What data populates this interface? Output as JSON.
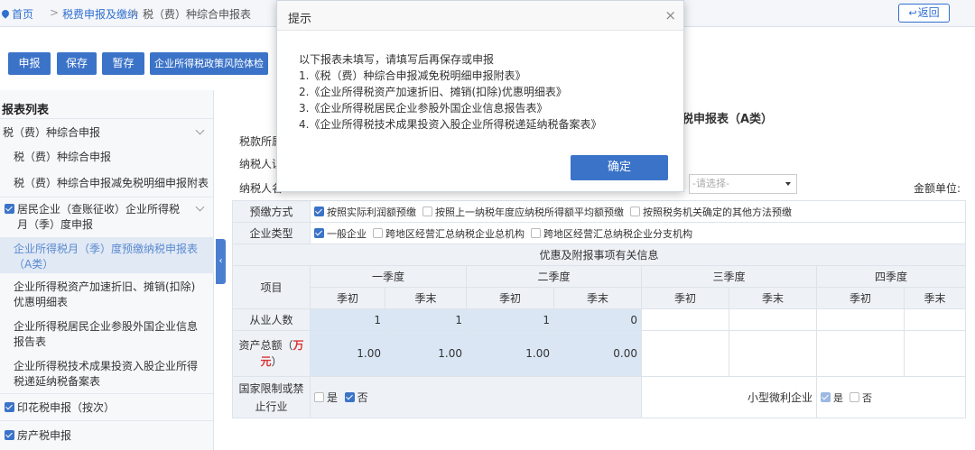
{
  "breadcrumb": {
    "home": "首页",
    "sep": ">",
    "tax": "税费申报及缴纳",
    "current": "税（费）种综合申报表",
    "back": "返回"
  },
  "toolbar": {
    "declare": "申报",
    "save": "保存",
    "stash": "暂存",
    "risk_check": "企业所得税政策风险体检"
  },
  "sidebar": {
    "title": "报表列表",
    "items": [
      {
        "label": "税（费）种综合申报"
      },
      {
        "label": "税（费）种综合申报"
      },
      {
        "label": "税（费）种综合申报减免税明细申报附表"
      },
      {
        "label": "居民企业（查账征收）企业所得税月（季）度申报"
      },
      {
        "label": "企业所得税月（季）度预缴纳税申报表（A类）"
      },
      {
        "label": "企业所得税资产加速折旧、摊销(扣除)优惠明细表"
      },
      {
        "label": "企业所得税居民企业参股外国企业信息报告表"
      },
      {
        "label": "企业所得税技术成果投资入股企业所得税递延纳税备案表"
      },
      {
        "label": "印花税申报（按次）"
      },
      {
        "label": "房产税申报"
      }
    ]
  },
  "main": {
    "title_tail": "税申报表（A类）",
    "label_period": "税款所属",
    "label_taxpayer_id": "纳税人识",
    "label_taxpayer_name": "纳税人名",
    "select_placeholder": "-请选择-",
    "unit_label": "金额单位:",
    "prepay_label": "预缴方式",
    "prepay_opt1": "按照实际利润额预缴",
    "prepay_opt2": "按照上一纳税年度应纳税所得额平均额预缴",
    "prepay_opt3": "按照税务机关确定的其他方法预缴",
    "type_label": "企业类型",
    "type_opt1": "一般企业",
    "type_opt2": "跨地区经营汇总纳税企业总机构",
    "type_opt3": "跨地区经营汇总纳税企业分支机构",
    "section_title": "优惠及附报事项有关信息",
    "col_item": "项目",
    "quarters": [
      "一季度",
      "二季度",
      "三季度",
      "四季度"
    ],
    "sub_start": "季初",
    "sub_end": "季末",
    "row_employees": "从业人数",
    "employees": [
      "1",
      "1",
      "1",
      "0"
    ],
    "row_assets_a": "资产总额（",
    "row_assets_unit": "万元",
    "row_assets_b": "）",
    "assets": [
      "1.00",
      "1.00",
      "1.00",
      "0.00"
    ],
    "row_restricted": "国家限制或禁止行业",
    "yes": "是",
    "no": "否",
    "small_micro": "小型微利企业"
  },
  "modal": {
    "title": "提示",
    "close": "×",
    "intro": "以下报表未填写，请填写后再保存或申报",
    "lines": [
      "1.《税（费）种综合申报减免税明细申报附表》",
      "2.《企业所得税资产加速折旧、摊销(扣除)优惠明细表》",
      "3.《企业所得税居民企业参股外国企业信息报告表》",
      "4.《企业所得税技术成果投资入股企业所得税递延纳税备案表》"
    ],
    "confirm": "确定"
  }
}
